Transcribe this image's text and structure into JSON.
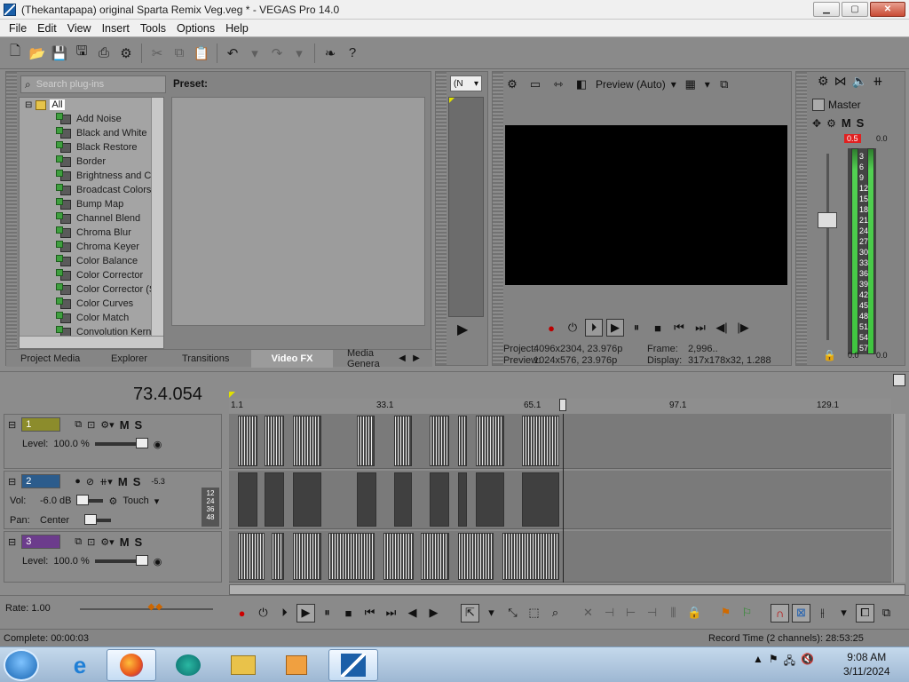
{
  "window": {
    "title": "(Thekantapapa) original Sparta Remix Veg.veg * - VEGAS Pro 14.0",
    "min": "▁",
    "max": "▢",
    "close": "✕"
  },
  "menu": [
    "File",
    "Edit",
    "View",
    "Insert",
    "Tools",
    "Options",
    "Help"
  ],
  "toolbar_icons": [
    "new-icon",
    "open-icon",
    "save-icon",
    "save-as-icon",
    "render-icon",
    "properties-icon",
    "cut-icon",
    "copy-icon",
    "paste-icon",
    "undo-icon",
    "redo-icon",
    "plugin-icon",
    "help-icon"
  ],
  "fx": {
    "search_placeholder": "Search plug-ins",
    "root": "All",
    "plugins": [
      "Add Noise",
      "Black and White",
      "Black Restore",
      "Border",
      "Brightness and Co",
      "Broadcast Colors",
      "Bump Map",
      "Channel Blend",
      "Chroma Blur",
      "Chroma Keyer",
      "Color Balance",
      "Color Corrector",
      "Color Corrector (S",
      "Color Curves",
      "Color Match",
      "Convolution Kerne"
    ],
    "preset_label": "Preset:",
    "tabs": [
      "Project Media",
      "Explorer",
      "Transitions",
      "Video FX",
      "Media Genera"
    ],
    "active_tab": "Video FX"
  },
  "trimmer": {
    "dropdown": "(N"
  },
  "preview": {
    "mode": "Preview (Auto)",
    "project_label": "Project:",
    "project_value": "4096x2304, 23.976p",
    "preview_label": "Preview:",
    "preview_value": "1024x576, 23.976p",
    "frame_label": "Frame:",
    "frame_value": "2,996..",
    "display_label": "Display:",
    "display_value": "317x178x32, 1.288"
  },
  "master": {
    "label": "Master",
    "m": "M",
    "s": "S",
    "peak_l": "0.5",
    "peak_r": "0.0",
    "bottom_l": "0.0",
    "bottom_r": "0.0",
    "ticks": [
      "3",
      "6",
      "9",
      "12",
      "15",
      "18",
      "21",
      "24",
      "27",
      "30",
      "33",
      "36",
      "39",
      "42",
      "45",
      "48",
      "51",
      "54",
      "57"
    ]
  },
  "timeline": {
    "timecode": "73.4.054",
    "ruler": [
      "1.1",
      "33.1",
      "65.1",
      "97.1",
      "129.1"
    ],
    "tracks": [
      {
        "num": "1",
        "level_label": "Level:",
        "level": "100.0 %",
        "m": "M",
        "s": "S"
      },
      {
        "num": "2",
        "vol_label": "Vol:",
        "vol": "-6.0 dB",
        "pan_label": "Pan:",
        "pan": "Center",
        "m": "M",
        "s": "S",
        "mode": "Touch",
        "meter_top": "-5.3",
        "meter_marks": [
          "12",
          "24",
          "36",
          "48"
        ]
      },
      {
        "num": "3",
        "level_label": "Level:",
        "level": "100.0 %",
        "m": "M",
        "s": "S"
      }
    ]
  },
  "transport": {
    "rate_label": "Rate:",
    "rate": "1.00"
  },
  "status": {
    "left": "Complete: 00:00:03",
    "right": "Record Time (2 channels): 28:53:25"
  },
  "taskbar": {
    "time": "9:08 AM",
    "date": "3/11/2024"
  },
  "colors": {
    "panel": "#838383",
    "peak": "#e02020",
    "meter": "#3fc53f",
    "taskbar": "#c5d9ec"
  }
}
